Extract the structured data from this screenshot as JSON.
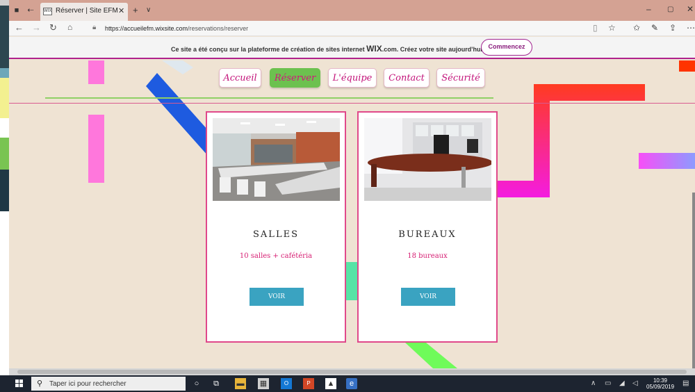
{
  "browser": {
    "tab_title": "Réserver | Site EFM",
    "tab_favicon": "WIX",
    "url_domain": "https://accueilefm.wixsite.com",
    "url_path": "/reservations/reserver"
  },
  "wix_banner": {
    "text_before": "Ce site a été conçu sur la plateforme de création de sites internet ",
    "logo": "WIX",
    "text_after": ".com. Créez votre site aujourd'hui.",
    "button": "Commencez"
  },
  "nav": {
    "items": [
      {
        "label": "Accueil"
      },
      {
        "label": "Réserver",
        "active": true
      },
      {
        "label": "L'équipe"
      },
      {
        "label": "Contact"
      },
      {
        "label": "Sécurité"
      }
    ]
  },
  "cards": [
    {
      "title": "SALLES",
      "subtitle": "10 salles + cafétéria",
      "button": "VOIR",
      "image": "meeting-room-photo"
    },
    {
      "title": "BUREAUX",
      "subtitle": "18 bureaux",
      "button": "VOIR",
      "image": "office-desk-photo"
    }
  ],
  "taskbar": {
    "search_placeholder": "Taper ici pour rechercher",
    "time": "10:39",
    "date": "05/09/2019"
  },
  "colors": {
    "accent_pink": "#d61d72",
    "nav_active": "#6cc14f",
    "button_teal": "#3aa3c1",
    "wix_purple": "#a1238f",
    "page_bg": "#efe3d3"
  }
}
